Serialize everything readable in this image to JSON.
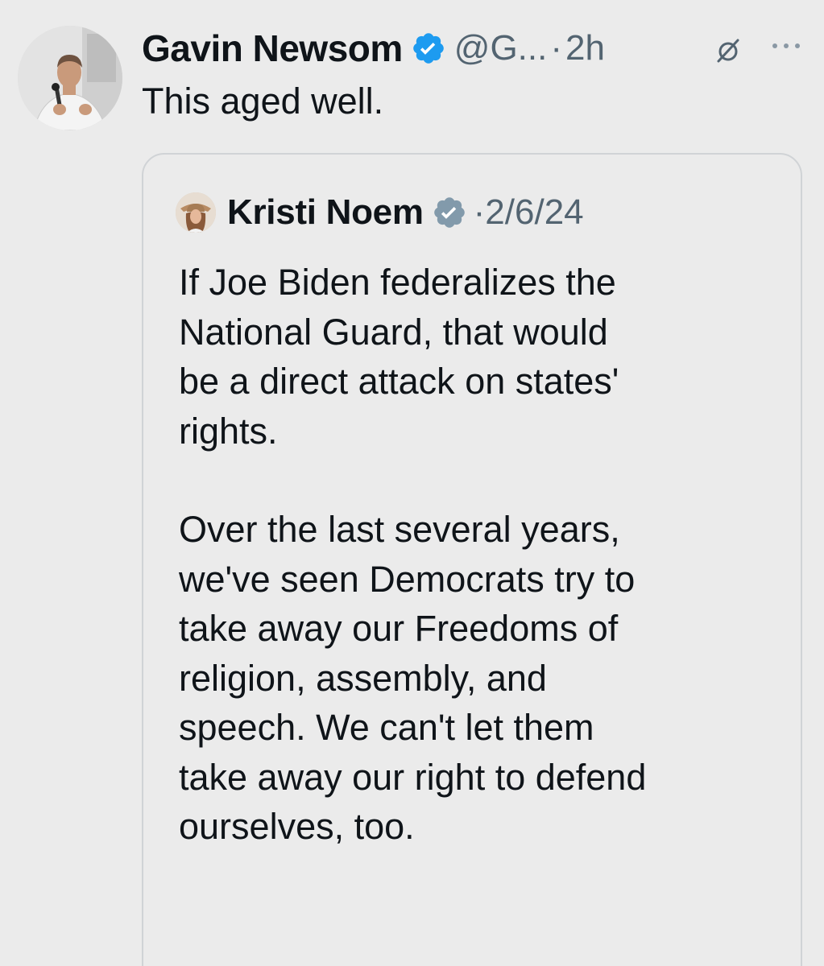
{
  "tweet": {
    "author_name": "Gavin Newsom",
    "handle": "@G...",
    "separator": "·",
    "time": "2h",
    "text": "This aged well.",
    "avatar_icon": "profile-photo-icon",
    "verified_icon": "verified-badge-icon"
  },
  "quoted_tweet": {
    "author_name": "Kristi Noem",
    "date": "·2/6/24",
    "paragraphs": [
      "If Joe Biden federalizes the\nNational Guard, that would\nbe a direct attack on states'\nrights.",
      "Over the last several years,\nwe've seen Democrats try to\ntake away our Freedoms of\nreligion, assembly, and\nspeech. We can't let them\ntake away our right to defend\nourselves, too."
    ],
    "verified_icon": "verified-badge-gray-icon"
  },
  "icons": {
    "grok": "grok-icon",
    "more": "more-options-icon"
  },
  "colors": {
    "background": "#ebebeb",
    "verified_blue": "#1d9bf0",
    "verified_gray": "#829aab",
    "secondary_text": "#536471",
    "border": "#d0d3d6"
  }
}
